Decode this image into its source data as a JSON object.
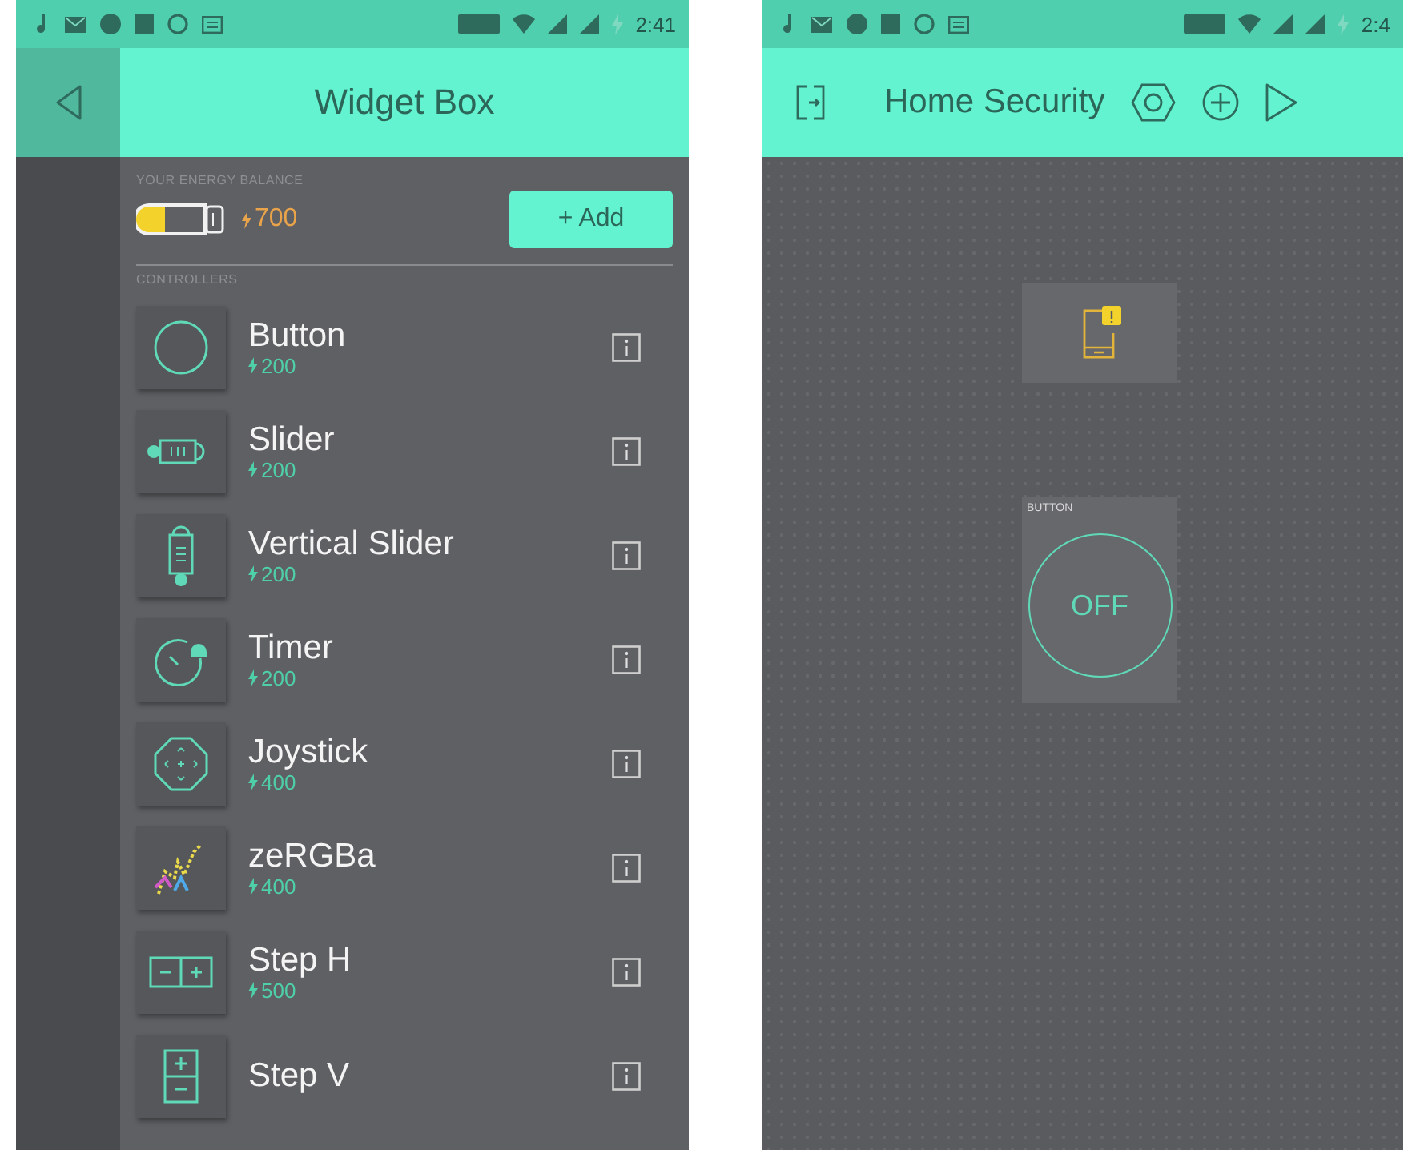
{
  "left_phone": {
    "status_bar": {
      "time": "2:41"
    },
    "header": {
      "title": "Widget Box"
    },
    "energy": {
      "label": "YOUR ENERGY BALANCE",
      "amount": "700",
      "add_button": "+ Add"
    },
    "section_label": "CONTROLLERS",
    "widgets": [
      {
        "kind": "button",
        "name": "Button",
        "price": "200"
      },
      {
        "kind": "slider",
        "name": "Slider",
        "price": "200"
      },
      {
        "kind": "vslider",
        "name": "Vertical Slider",
        "price": "200"
      },
      {
        "kind": "timer",
        "name": "Timer",
        "price": "200"
      },
      {
        "kind": "joystick",
        "name": "Joystick",
        "price": "400"
      },
      {
        "kind": "zergba",
        "name": "zeRGBa",
        "price": "400"
      },
      {
        "kind": "steph",
        "name": "Step H",
        "price": "500"
      },
      {
        "kind": "stepv",
        "name": "Step V"
      }
    ]
  },
  "right_phone": {
    "status_bar": {
      "time": "2:4"
    },
    "header": {
      "title": "Home Security"
    },
    "canvas": {
      "widgets": [
        {
          "kind": "notification"
        },
        {
          "kind": "button",
          "label": "BUTTON",
          "state_text": "OFF"
        }
      ]
    }
  }
}
